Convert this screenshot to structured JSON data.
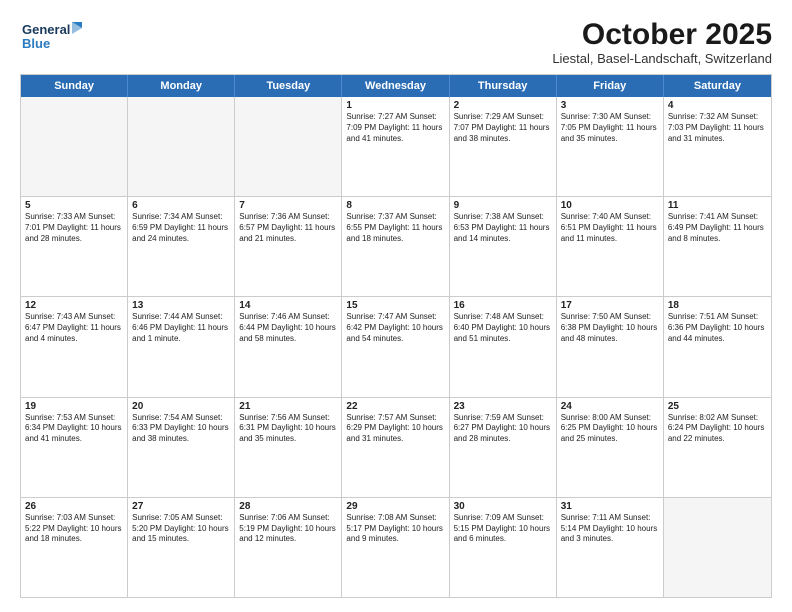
{
  "logo": {
    "line1": "General",
    "line2": "Blue"
  },
  "title": "October 2025",
  "subtitle": "Liestal, Basel-Landschaft, Switzerland",
  "days_of_week": [
    "Sunday",
    "Monday",
    "Tuesday",
    "Wednesday",
    "Thursday",
    "Friday",
    "Saturday"
  ],
  "weeks": [
    [
      {
        "day": "",
        "info": "",
        "empty": true
      },
      {
        "day": "",
        "info": "",
        "empty": true
      },
      {
        "day": "",
        "info": "",
        "empty": true
      },
      {
        "day": "1",
        "info": "Sunrise: 7:27 AM\nSunset: 7:09 PM\nDaylight: 11 hours and 41 minutes."
      },
      {
        "day": "2",
        "info": "Sunrise: 7:29 AM\nSunset: 7:07 PM\nDaylight: 11 hours and 38 minutes."
      },
      {
        "day": "3",
        "info": "Sunrise: 7:30 AM\nSunset: 7:05 PM\nDaylight: 11 hours and 35 minutes."
      },
      {
        "day": "4",
        "info": "Sunrise: 7:32 AM\nSunset: 7:03 PM\nDaylight: 11 hours and 31 minutes."
      }
    ],
    [
      {
        "day": "5",
        "info": "Sunrise: 7:33 AM\nSunset: 7:01 PM\nDaylight: 11 hours and 28 minutes."
      },
      {
        "day": "6",
        "info": "Sunrise: 7:34 AM\nSunset: 6:59 PM\nDaylight: 11 hours and 24 minutes."
      },
      {
        "day": "7",
        "info": "Sunrise: 7:36 AM\nSunset: 6:57 PM\nDaylight: 11 hours and 21 minutes."
      },
      {
        "day": "8",
        "info": "Sunrise: 7:37 AM\nSunset: 6:55 PM\nDaylight: 11 hours and 18 minutes."
      },
      {
        "day": "9",
        "info": "Sunrise: 7:38 AM\nSunset: 6:53 PM\nDaylight: 11 hours and 14 minutes."
      },
      {
        "day": "10",
        "info": "Sunrise: 7:40 AM\nSunset: 6:51 PM\nDaylight: 11 hours and 11 minutes."
      },
      {
        "day": "11",
        "info": "Sunrise: 7:41 AM\nSunset: 6:49 PM\nDaylight: 11 hours and 8 minutes."
      }
    ],
    [
      {
        "day": "12",
        "info": "Sunrise: 7:43 AM\nSunset: 6:47 PM\nDaylight: 11 hours and 4 minutes."
      },
      {
        "day": "13",
        "info": "Sunrise: 7:44 AM\nSunset: 6:46 PM\nDaylight: 11 hours and 1 minute."
      },
      {
        "day": "14",
        "info": "Sunrise: 7:46 AM\nSunset: 6:44 PM\nDaylight: 10 hours and 58 minutes."
      },
      {
        "day": "15",
        "info": "Sunrise: 7:47 AM\nSunset: 6:42 PM\nDaylight: 10 hours and 54 minutes."
      },
      {
        "day": "16",
        "info": "Sunrise: 7:48 AM\nSunset: 6:40 PM\nDaylight: 10 hours and 51 minutes."
      },
      {
        "day": "17",
        "info": "Sunrise: 7:50 AM\nSunset: 6:38 PM\nDaylight: 10 hours and 48 minutes."
      },
      {
        "day": "18",
        "info": "Sunrise: 7:51 AM\nSunset: 6:36 PM\nDaylight: 10 hours and 44 minutes."
      }
    ],
    [
      {
        "day": "19",
        "info": "Sunrise: 7:53 AM\nSunset: 6:34 PM\nDaylight: 10 hours and 41 minutes."
      },
      {
        "day": "20",
        "info": "Sunrise: 7:54 AM\nSunset: 6:33 PM\nDaylight: 10 hours and 38 minutes."
      },
      {
        "day": "21",
        "info": "Sunrise: 7:56 AM\nSunset: 6:31 PM\nDaylight: 10 hours and 35 minutes."
      },
      {
        "day": "22",
        "info": "Sunrise: 7:57 AM\nSunset: 6:29 PM\nDaylight: 10 hours and 31 minutes."
      },
      {
        "day": "23",
        "info": "Sunrise: 7:59 AM\nSunset: 6:27 PM\nDaylight: 10 hours and 28 minutes."
      },
      {
        "day": "24",
        "info": "Sunrise: 8:00 AM\nSunset: 6:25 PM\nDaylight: 10 hours and 25 minutes."
      },
      {
        "day": "25",
        "info": "Sunrise: 8:02 AM\nSunset: 6:24 PM\nDaylight: 10 hours and 22 minutes."
      }
    ],
    [
      {
        "day": "26",
        "info": "Sunrise: 7:03 AM\nSunset: 5:22 PM\nDaylight: 10 hours and 18 minutes."
      },
      {
        "day": "27",
        "info": "Sunrise: 7:05 AM\nSunset: 5:20 PM\nDaylight: 10 hours and 15 minutes."
      },
      {
        "day": "28",
        "info": "Sunrise: 7:06 AM\nSunset: 5:19 PM\nDaylight: 10 hours and 12 minutes."
      },
      {
        "day": "29",
        "info": "Sunrise: 7:08 AM\nSunset: 5:17 PM\nDaylight: 10 hours and 9 minutes."
      },
      {
        "day": "30",
        "info": "Sunrise: 7:09 AM\nSunset: 5:15 PM\nDaylight: 10 hours and 6 minutes."
      },
      {
        "day": "31",
        "info": "Sunrise: 7:11 AM\nSunset: 5:14 PM\nDaylight: 10 hours and 3 minutes."
      },
      {
        "day": "",
        "info": "",
        "empty": true
      }
    ]
  ]
}
